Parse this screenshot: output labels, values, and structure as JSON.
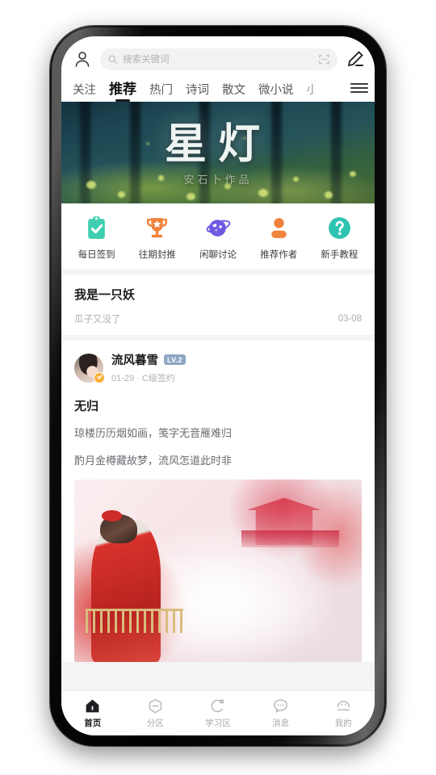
{
  "app": {
    "search": {
      "placeholder": "搜索关键词",
      "search_icon": "search-icon",
      "scan_icon": "scan-icon"
    },
    "profile_icon": "user-avatar-icon",
    "compose_icon": "pencil-edit-icon",
    "menu_icon": "hamburger-menu-icon"
  },
  "tabs": [
    {
      "label": "关注",
      "active": false
    },
    {
      "label": "推荐",
      "active": true
    },
    {
      "label": "热门",
      "active": false
    },
    {
      "label": "诗词",
      "active": false
    },
    {
      "label": "散文",
      "active": false
    },
    {
      "label": "微小说",
      "active": false
    },
    {
      "label": "小",
      "active": false
    }
  ],
  "banner": {
    "title": "星灯",
    "subtitle": "安石卜作品"
  },
  "quick_actions": [
    {
      "label": "每日签到",
      "icon": "clipboard-check-icon",
      "color": "#3ecfb0"
    },
    {
      "label": "往期封推",
      "icon": "trophy-icon",
      "color": "#f0833c"
    },
    {
      "label": "闲聊讨论",
      "icon": "planet-icon",
      "color": "#6f5ae0"
    },
    {
      "label": "推荐作者",
      "icon": "person-icon",
      "color": "#f0833c"
    },
    {
      "label": "新手教程",
      "icon": "question-circle-icon",
      "color": "#2ec4b0"
    }
  ],
  "simple_card": {
    "title": "我是一只妖",
    "subtitle": "瓜子又没了",
    "date": "03-08"
  },
  "feed_post": {
    "author": "流风暮雪",
    "level_badge": "LV.2",
    "meta": "01-29  ·  C级签约",
    "title": "无归",
    "lines": [
      "琼楼历历烟如画，笺字无音雁难归",
      "酌月金樽藏故梦，流风怎道此时非"
    ],
    "image_alt": "红衣女子与楼阁水墨插画"
  },
  "bottom_nav": [
    {
      "label": "首页",
      "icon": "home-icon",
      "active": true
    },
    {
      "label": "分区",
      "icon": "hexagon-minus-icon",
      "active": false
    },
    {
      "label": "学习区",
      "icon": "study-circle-icon",
      "active": false
    },
    {
      "label": "消息",
      "icon": "chat-bubble-icon",
      "active": false
    },
    {
      "label": "我的",
      "icon": "profile-circle-icon",
      "active": false
    }
  ],
  "colors": {
    "accent_dark": "#1a1a1a",
    "muted_text": "#b0b0b6",
    "level_badge_bg": "#8fa6c4",
    "verify_badge_bg": "#fbb03b"
  }
}
